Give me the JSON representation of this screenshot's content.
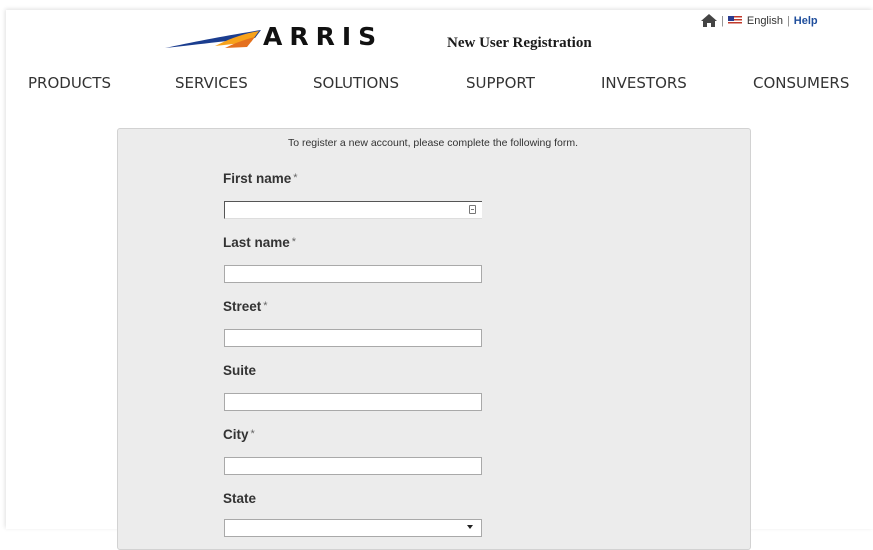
{
  "brand": {
    "name": "ARRIS",
    "accent": "#f7a21b",
    "swoosh": "#1b3d8f"
  },
  "header": {
    "title": "New User Registration"
  },
  "utility": {
    "home_icon": "home-icon",
    "language": "English",
    "separator": "|",
    "help": "Help"
  },
  "nav": {
    "items": [
      "PRODUCTS",
      "SERVICES",
      "SOLUTIONS",
      "SUPPORT",
      "INVESTORS",
      "CONSUMERS"
    ]
  },
  "form": {
    "intro": "To register a new account, please complete the following form.",
    "required_marker": "*",
    "fields": [
      {
        "label": "First name",
        "required": true,
        "value": ""
      },
      {
        "label": "Last name",
        "required": true,
        "value": ""
      },
      {
        "label": "Street",
        "required": true,
        "value": ""
      },
      {
        "label": "Suite",
        "required": false,
        "value": ""
      },
      {
        "label": "City",
        "required": true,
        "value": ""
      },
      {
        "label": "State",
        "required": false,
        "value": ""
      }
    ]
  }
}
